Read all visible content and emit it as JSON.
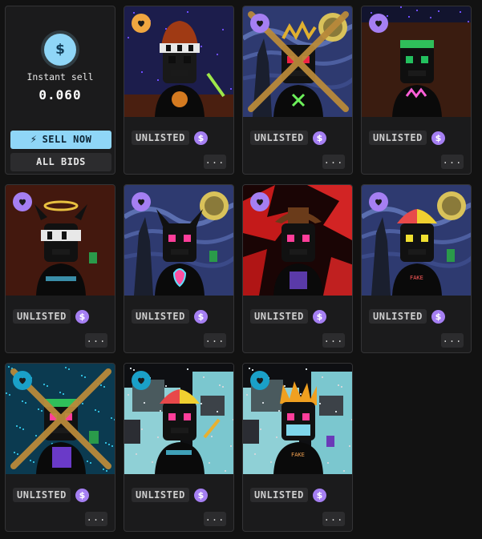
{
  "sell_panel": {
    "icon": "dollar-icon",
    "icon_glyph": "$",
    "label": "Instant sell",
    "price": "0.060",
    "sell_button": "SELL NOW",
    "sell_button_icon": "lightning-icon",
    "bids_button": "ALL BIDS"
  },
  "colors": {
    "accent_blue": "#8fd6f7",
    "coin_purple": "#a57ff2",
    "fav_orange": "#f0a640",
    "fav_purple": "#a57ff2",
    "fav_teal": "#1aa0c8"
  },
  "currency_glyph": "$",
  "more_label": "...",
  "items": [
    {
      "status": "UNLISTED",
      "fav_color": "orange",
      "art": "hat",
      "crossed": false
    },
    {
      "status": "UNLISTED",
      "fav_color": "purple",
      "art": "starry",
      "crossed": true
    },
    {
      "status": "UNLISTED",
      "fav_color": "purple",
      "art": "dark",
      "crossed": false
    },
    {
      "status": "UNLISTED",
      "fav_color": "purple",
      "art": "halo",
      "crossed": false
    },
    {
      "status": "UNLISTED",
      "fav_color": "purple",
      "art": "starry-devil",
      "crossed": false
    },
    {
      "status": "UNLISTED",
      "fav_color": "purple",
      "art": "red-cowboy",
      "crossed": false
    },
    {
      "status": "UNLISTED",
      "fav_color": "purple",
      "art": "starry-propeller",
      "crossed": false
    },
    {
      "status": "UNLISTED",
      "fav_color": "teal",
      "art": "glitch-blue",
      "crossed": true
    },
    {
      "status": "UNLISTED",
      "fav_color": "teal",
      "art": "ruin-propeller",
      "crossed": false
    },
    {
      "status": "UNLISTED",
      "fav_color": "teal",
      "art": "ruin-spiky",
      "crossed": false
    }
  ]
}
